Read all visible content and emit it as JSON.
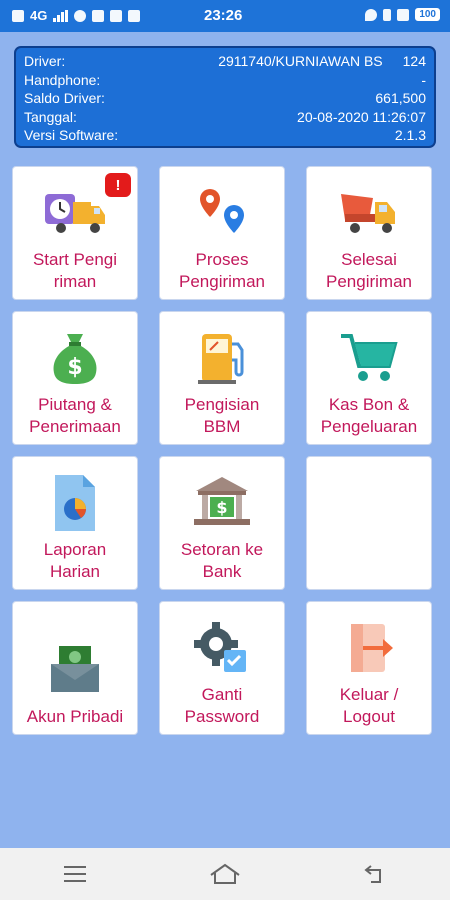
{
  "status_bar": {
    "network": "4G",
    "time": "23:26",
    "battery": "100"
  },
  "info": {
    "rows": [
      {
        "label": "Driver:",
        "value": "2911740/KURNIAWAN BS",
        "extra": "124"
      },
      {
        "label": "Handphone:",
        "value": "-",
        "extra": ""
      },
      {
        "label": "Saldo Driver:",
        "value": "661,500",
        "extra": ""
      },
      {
        "label": "Tanggal:",
        "value": "20-08-2020 11:26:07",
        "extra": ""
      },
      {
        "label": "Versi Software:",
        "value": "2.1.3",
        "extra": ""
      }
    ]
  },
  "menu": {
    "start": {
      "label": "Start Pengi\nriman",
      "badge": "!",
      "icon": "truck-clock-icon"
    },
    "proses": {
      "label": "Proses\nPengiriman",
      "icon": "map-pins-icon"
    },
    "selesai": {
      "label": "Selesai\nPengiriman",
      "icon": "dump-truck-icon"
    },
    "piutang": {
      "label": "Piutang &\nPenerimaan",
      "icon": "money-bag-icon"
    },
    "bbm": {
      "label": "Pengisian\nBBM",
      "icon": "fuel-pump-icon"
    },
    "kasbon": {
      "label": "Kas Bon &\nPengeluaran",
      "icon": "shopping-cart-icon"
    },
    "laporan": {
      "label": "Laporan\nHarian",
      "icon": "report-chart-icon"
    },
    "setoran": {
      "label": "Setoran ke\nBank",
      "icon": "bank-icon"
    },
    "akun": {
      "label": "Akun Pribadi",
      "icon": "wallet-icon"
    },
    "password": {
      "label": "Ganti\nPassword",
      "icon": "gear-icon"
    },
    "keluar": {
      "label": "Keluar /\nLogout",
      "icon": "logout-arrow-icon"
    }
  },
  "colors": {
    "background": "#8fb3ee",
    "header": "#1d6fd6",
    "label": "#c2185b",
    "badge": "#e31b1b"
  }
}
